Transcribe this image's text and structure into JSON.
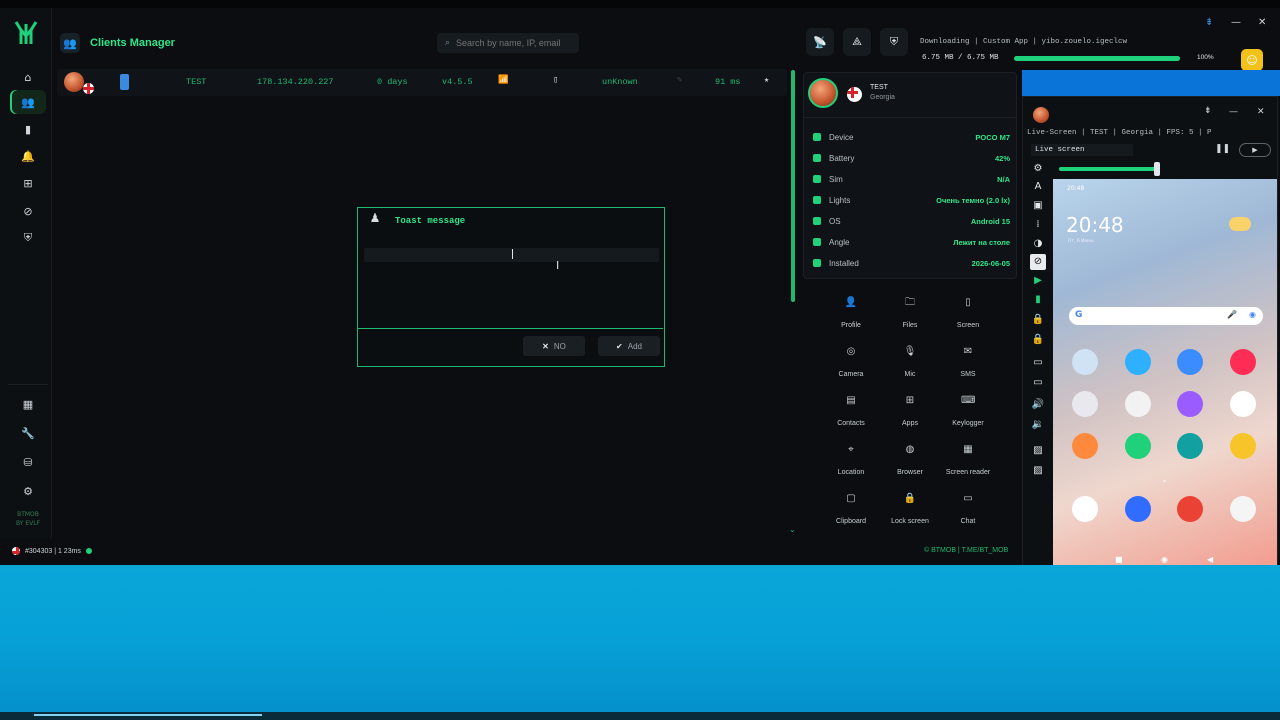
{
  "sidebar": {
    "footer_line1": "BTMOB",
    "footer_line2": "BY EVLF"
  },
  "header": {
    "title": "Clients Manager",
    "search_placeholder": "Search by name, IP, email"
  },
  "client": {
    "name": "TEST",
    "ip": "178.134.220.227",
    "age": "0 days",
    "version": "v4.5.5",
    "status": "unKnown",
    "ping": "91 ms"
  },
  "toast": {
    "title": "Toast message",
    "no_label": "NO",
    "add_label": "Add"
  },
  "device": {
    "name": "TEST",
    "country": "Georgia",
    "props": [
      {
        "label": "Device",
        "value": "POCO M7",
        "icon": "device-icon"
      },
      {
        "label": "Battery",
        "value": "42%",
        "icon": "battery-icon"
      },
      {
        "label": "Sim",
        "value": "N/A",
        "icon": "sim-icon"
      },
      {
        "label": "Lights",
        "value": "Очень темно (2.0 lx)",
        "icon": "lights-icon"
      },
      {
        "label": "OS",
        "value": "Android 15",
        "icon": "android-icon"
      },
      {
        "label": "Angle",
        "value": "Лежит на столе",
        "icon": "angle-icon"
      },
      {
        "label": "Installed",
        "value": "2026-06-05",
        "icon": "calendar-icon"
      }
    ]
  },
  "actions": [
    {
      "label": "Profile",
      "icon": "profile-icon",
      "glyph": "👤"
    },
    {
      "label": "Files",
      "icon": "folder-icon",
      "glyph": "🗀"
    },
    {
      "label": "Screen",
      "icon": "screen-icon",
      "glyph": "▯"
    },
    {
      "label": "Camera",
      "icon": "camera-icon",
      "glyph": "◎"
    },
    {
      "label": "Mic",
      "icon": "mic-icon",
      "glyph": "🎙"
    },
    {
      "label": "SMS",
      "icon": "sms-icon",
      "glyph": "✉"
    },
    {
      "label": "Contacts",
      "icon": "contacts-icon",
      "glyph": "▤"
    },
    {
      "label": "Apps",
      "icon": "apps-icon",
      "glyph": "⊞"
    },
    {
      "label": "Keylogger",
      "icon": "keyboard-icon",
      "glyph": "⌨"
    },
    {
      "label": "Location",
      "icon": "location-icon",
      "glyph": "⌖"
    },
    {
      "label": "Browser",
      "icon": "browser-icon",
      "glyph": "◍"
    },
    {
      "label": "Screen reader",
      "icon": "screen-reader-icon",
      "glyph": "▦"
    },
    {
      "label": "Clipboard",
      "icon": "clipboard-icon",
      "glyph": "▢"
    },
    {
      "label": "Lock screen",
      "icon": "lock-icon",
      "glyph": "🔒"
    },
    {
      "label": "Chat",
      "icon": "chat-icon",
      "glyph": "▭"
    }
  ],
  "status": {
    "left": "#304303 | 1   23ms",
    "right": "© BTMOB | T.ME/BT_MOB"
  },
  "download": {
    "text": "Downloading | Custom App | yibo.zouelo.igeclcw",
    "size": "6.75 MB / 6.75 MB",
    "percent": "100%",
    "progress": 1.0
  },
  "live": {
    "title": "Live-Screen | TEST | Georgia | FPS: 5 | P",
    "mode": "Live screen",
    "phone_time": "20:48",
    "phone_clock": "20:48",
    "phone_date": "Пт, 6 Июнь"
  },
  "colors": {
    "accent": "#1fd17a",
    "background": "#0b0d10",
    "desktop": "#06a0d6"
  }
}
